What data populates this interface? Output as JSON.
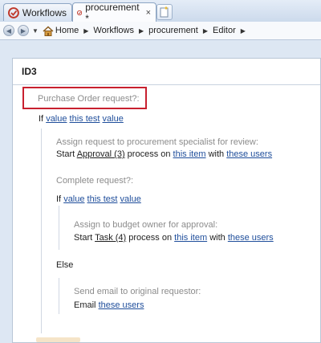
{
  "tabs": [
    {
      "label": "Workflows",
      "icon": "workflow-icon"
    },
    {
      "label": "procurement *",
      "icon": "workflow-icon",
      "close": "×"
    }
  ],
  "breadcrumb": [
    "Home",
    "Workflows",
    "procurement",
    "Editor"
  ],
  "editor": {
    "title": "ID3",
    "step1_title": "Purchase Order request?:",
    "if_keyword": "If",
    "value1": "value",
    "this_test": "this test",
    "value2": "value",
    "assign_desc": "Assign request to procurement specialist for review:",
    "start_word": "Start",
    "approval_link": "Approval (3)",
    "process_on": "process on",
    "this_item": "this item",
    "with_word": "with",
    "these_users": "these users",
    "complete_title": "Complete request?:",
    "budget_desc": "Assign to budget owner for approval:",
    "task_link": "Task (4)",
    "else_keyword": "Else",
    "email_desc": "Send email to original requestor:",
    "email_word": "Email"
  },
  "colors": {
    "link": "#1f4e9b",
    "highlight_box": "#c8202f"
  }
}
